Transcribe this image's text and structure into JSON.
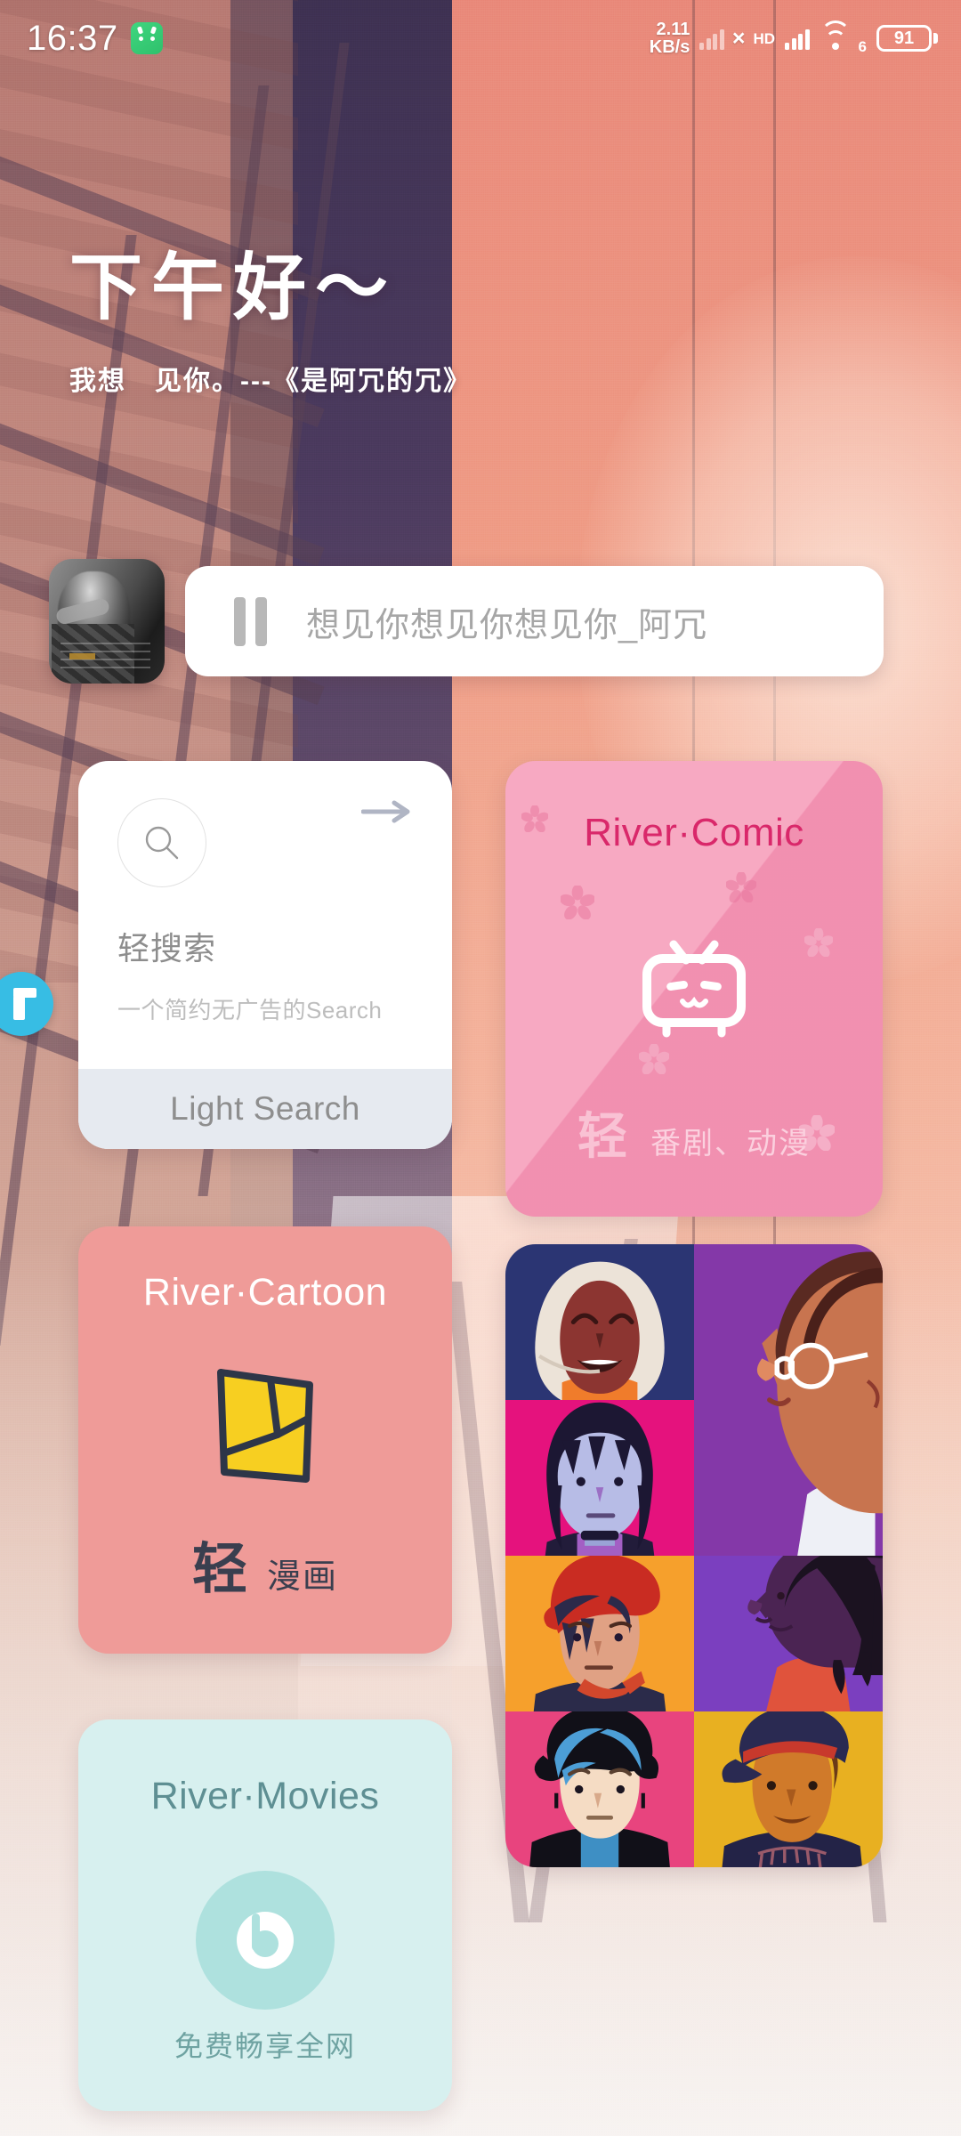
{
  "status_bar": {
    "time": "16:37",
    "app_icon": "android-robot-icon",
    "network_speed_value": "2.11",
    "network_speed_unit": "KB/s",
    "sim_no_signal": "×",
    "hd_label": "HD",
    "wifi_generation": "6",
    "battery_percent": "91"
  },
  "greeting": {
    "title": "下午好～",
    "subtitle": "我想　见你。---《是阿冗的冗》"
  },
  "music_player": {
    "pause_icon": "pause-icon",
    "track_title": "想见你想见你想见你_阿冗",
    "album_art": "album-art-grayscale-photo"
  },
  "edge_badge": {
    "glyph": "t-letter-icon",
    "color": "#37bde4"
  },
  "widgets": {
    "light_search": {
      "search_icon": "search-icon",
      "arrow_icon": "arrow-right-icon",
      "title": "轻搜索",
      "description": "一个简约无广告的Search",
      "footer_label": "Light Search",
      "footer_bg": "#e6eaf0"
    },
    "river_comic": {
      "title": "River·Comic",
      "icon": "bilibili-tv-icon",
      "badge": "轻",
      "subtitle": "番剧、动漫",
      "bg": "#f7a9c2",
      "title_color": "#d9286a"
    },
    "river_cartoon": {
      "title": "River·Cartoon",
      "icon": "yellow-quadrilateral-icon",
      "badge": "轻",
      "subtitle": "漫画",
      "bg": "#ef9b98",
      "accent_bar": "#e8402b"
    },
    "river_movies": {
      "title": "River·Movies",
      "icon": "beats-b-icon",
      "subtitle": "免费畅享全网",
      "bg": "#d7f0ef",
      "title_color": "#5e8f93"
    },
    "avatar_grid": {
      "name": "avatar-collage-widget",
      "tiles": [
        {
          "label": "woman-hijab-avatar",
          "bg": "#2b3573"
        },
        {
          "label": "man-glasses-avatar",
          "bg": "#8438a8"
        },
        {
          "label": "woman-bob-avatar",
          "bg": "#e5127d"
        },
        {
          "label": "man-glasses-avatar-2",
          "bg": "#8438a8"
        },
        {
          "label": "person-beret-avatar",
          "bg": "#f6a02c"
        },
        {
          "label": "woman-braids-avatar",
          "bg": "#7b3fbf"
        },
        {
          "label": "person-hat-avatar",
          "bg": "#e8447e"
        },
        {
          "label": "man-cap-avatar",
          "bg": "#e8b021"
        }
      ]
    },
    "green_card": {
      "name": "green-widget",
      "bg": "#92ce8b"
    }
  }
}
